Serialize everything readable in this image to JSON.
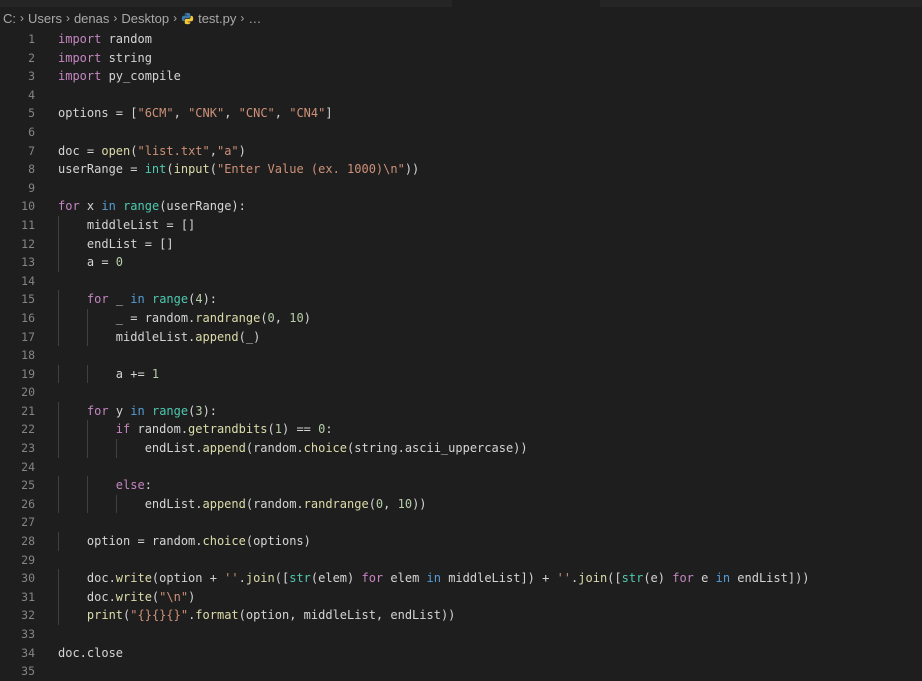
{
  "breadcrumb": {
    "segments": [
      "C:",
      "Users",
      "denas",
      "Desktop"
    ],
    "file": "test.py",
    "more": "…",
    "separator": "›"
  },
  "editor": {
    "language": "python",
    "lines": [
      [
        {
          "t": "import",
          "c": "kw-purple"
        },
        {
          "t": " random"
        }
      ],
      [
        {
          "t": "import",
          "c": "kw-purple"
        },
        {
          "t": " string"
        }
      ],
      [
        {
          "t": "import",
          "c": "kw-purple"
        },
        {
          "t": " py_compile"
        }
      ],
      [],
      [
        {
          "t": "options = ["
        },
        {
          "t": "\"6CM\"",
          "c": "str"
        },
        {
          "t": ", "
        },
        {
          "t": "\"CNK\"",
          "c": "str"
        },
        {
          "t": ", "
        },
        {
          "t": "\"CNC\"",
          "c": "str"
        },
        {
          "t": ", "
        },
        {
          "t": "\"CN4\"",
          "c": "str"
        },
        {
          "t": "]"
        }
      ],
      [],
      [
        {
          "t": "doc = "
        },
        {
          "t": "open",
          "c": "fn"
        },
        {
          "t": "("
        },
        {
          "t": "\"list.txt\"",
          "c": "str"
        },
        {
          "t": ","
        },
        {
          "t": "\"a\"",
          "c": "str"
        },
        {
          "t": ")"
        }
      ],
      [
        {
          "t": "userRange = "
        },
        {
          "t": "int",
          "c": "cls"
        },
        {
          "t": "("
        },
        {
          "t": "input",
          "c": "fn"
        },
        {
          "t": "("
        },
        {
          "t": "\"Enter Value (ex. 1000)\\n\"",
          "c": "str"
        },
        {
          "t": "))"
        }
      ],
      [],
      [
        {
          "t": "for",
          "c": "kw-purple"
        },
        {
          "t": " x "
        },
        {
          "t": "in",
          "c": "kw-blue"
        },
        {
          "t": " "
        },
        {
          "t": "range",
          "c": "cls"
        },
        {
          "t": "(userRange):"
        }
      ],
      [
        {
          "t": "    middleList = []"
        }
      ],
      [
        {
          "t": "    endList = []"
        }
      ],
      [
        {
          "t": "    a = "
        },
        {
          "t": "0",
          "c": "num"
        }
      ],
      [],
      [
        {
          "t": "    "
        },
        {
          "t": "for",
          "c": "kw-purple"
        },
        {
          "t": " _ "
        },
        {
          "t": "in",
          "c": "kw-blue"
        },
        {
          "t": " "
        },
        {
          "t": "range",
          "c": "cls"
        },
        {
          "t": "("
        },
        {
          "t": "4",
          "c": "num"
        },
        {
          "t": "):"
        }
      ],
      [
        {
          "t": "        _ = random."
        },
        {
          "t": "randrange",
          "c": "fn"
        },
        {
          "t": "("
        },
        {
          "t": "0",
          "c": "num"
        },
        {
          "t": ", "
        },
        {
          "t": "10",
          "c": "num"
        },
        {
          "t": ")"
        }
      ],
      [
        {
          "t": "        middleList."
        },
        {
          "t": "append",
          "c": "fn"
        },
        {
          "t": "(_)"
        }
      ],
      [],
      [
        {
          "t": "        a += "
        },
        {
          "t": "1",
          "c": "num"
        }
      ],
      [],
      [
        {
          "t": "    "
        },
        {
          "t": "for",
          "c": "kw-purple"
        },
        {
          "t": " y "
        },
        {
          "t": "in",
          "c": "kw-blue"
        },
        {
          "t": " "
        },
        {
          "t": "range",
          "c": "cls"
        },
        {
          "t": "("
        },
        {
          "t": "3",
          "c": "num"
        },
        {
          "t": "):"
        }
      ],
      [
        {
          "t": "        "
        },
        {
          "t": "if",
          "c": "kw-purple"
        },
        {
          "t": " random."
        },
        {
          "t": "getrandbits",
          "c": "fn"
        },
        {
          "t": "("
        },
        {
          "t": "1",
          "c": "num"
        },
        {
          "t": ") == "
        },
        {
          "t": "0",
          "c": "num"
        },
        {
          "t": ":"
        }
      ],
      [
        {
          "t": "            endList."
        },
        {
          "t": "append",
          "c": "fn"
        },
        {
          "t": "(random."
        },
        {
          "t": "choice",
          "c": "fn"
        },
        {
          "t": "(string.ascii_uppercase))"
        }
      ],
      [],
      [
        {
          "t": "        "
        },
        {
          "t": "else",
          "c": "kw-purple"
        },
        {
          "t": ":"
        }
      ],
      [
        {
          "t": "            endList."
        },
        {
          "t": "append",
          "c": "fn"
        },
        {
          "t": "(random."
        },
        {
          "t": "randrange",
          "c": "fn"
        },
        {
          "t": "("
        },
        {
          "t": "0",
          "c": "num"
        },
        {
          "t": ", "
        },
        {
          "t": "10",
          "c": "num"
        },
        {
          "t": "))"
        }
      ],
      [],
      [
        {
          "t": "    option = random."
        },
        {
          "t": "choice",
          "c": "fn"
        },
        {
          "t": "(options)"
        }
      ],
      [],
      [
        {
          "t": "    doc."
        },
        {
          "t": "write",
          "c": "fn"
        },
        {
          "t": "(option + "
        },
        {
          "t": "''",
          "c": "str"
        },
        {
          "t": "."
        },
        {
          "t": "join",
          "c": "fn"
        },
        {
          "t": "(["
        },
        {
          "t": "str",
          "c": "cls"
        },
        {
          "t": "(elem) "
        },
        {
          "t": "for",
          "c": "kw-purple"
        },
        {
          "t": " elem "
        },
        {
          "t": "in",
          "c": "kw-blue"
        },
        {
          "t": " middleList]) + "
        },
        {
          "t": "''",
          "c": "str"
        },
        {
          "t": "."
        },
        {
          "t": "join",
          "c": "fn"
        },
        {
          "t": "(["
        },
        {
          "t": "str",
          "c": "cls"
        },
        {
          "t": "(e) "
        },
        {
          "t": "for",
          "c": "kw-purple"
        },
        {
          "t": " e "
        },
        {
          "t": "in",
          "c": "kw-blue"
        },
        {
          "t": " endList]))"
        }
      ],
      [
        {
          "t": "    doc."
        },
        {
          "t": "write",
          "c": "fn"
        },
        {
          "t": "("
        },
        {
          "t": "\"\\n\"",
          "c": "str"
        },
        {
          "t": ")"
        }
      ],
      [
        {
          "t": "    "
        },
        {
          "t": "print",
          "c": "fn"
        },
        {
          "t": "("
        },
        {
          "t": "\"{}{}{}\"",
          "c": "str"
        },
        {
          "t": "."
        },
        {
          "t": "format",
          "c": "fn"
        },
        {
          "t": "(option, middleList, endList))"
        }
      ],
      [],
      [
        {
          "t": "doc.close"
        }
      ],
      []
    ]
  },
  "colors": {
    "background": "#1e1e1e",
    "keyword": "#c586c0",
    "keyword_in": "#569cd6",
    "function": "#dcdcaa",
    "string": "#ce9178",
    "number": "#b5cea8",
    "builtin_class": "#4ec9b0",
    "line_number": "#858585"
  }
}
